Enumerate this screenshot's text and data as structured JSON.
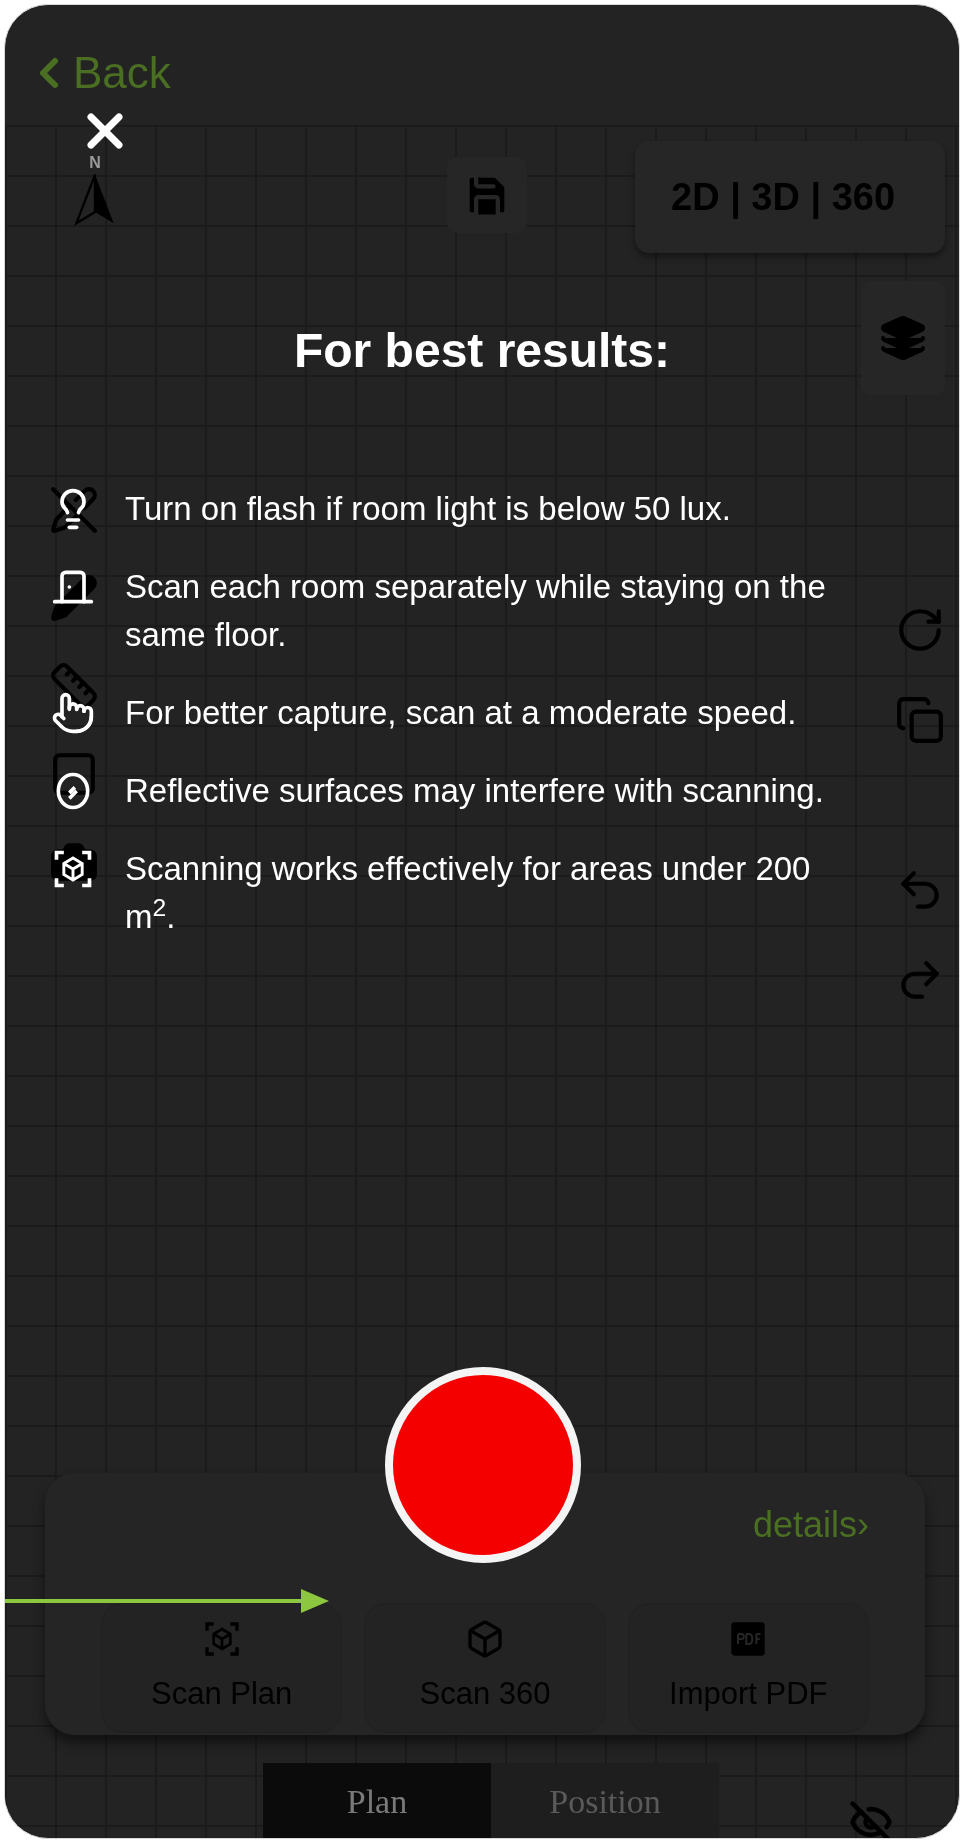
{
  "header": {
    "back_label": "Back"
  },
  "compass": {
    "label": "N"
  },
  "view_switch": {
    "label": "2D | 3D | 360"
  },
  "tips": {
    "title": "For best results:",
    "items": [
      {
        "kind": "light",
        "text": "Turn on flash if room light is below 50 lux."
      },
      {
        "kind": "room",
        "text": "Scan each room separately while staying on the same floor."
      },
      {
        "kind": "speed",
        "text": "For better capture, scan at a moderate speed."
      },
      {
        "kind": "mirror",
        "text": "Reflective surfaces may interfere with scanning."
      },
      {
        "kind": "area",
        "text": "Scanning works effectively for areas under 200 m$^{2}$."
      }
    ]
  },
  "scan_panel": {
    "details_link": "details›",
    "actions": [
      {
        "kind": "scan",
        "label": "Scan Plan"
      },
      {
        "kind": "panorama",
        "label": "Scan 360"
      },
      {
        "kind": "pdf",
        "label": "Import PDF"
      }
    ]
  },
  "mode_tabs": [
    {
      "label": "Plan",
      "selected": true
    },
    {
      "label": "Position",
      "selected": false
    }
  ]
}
